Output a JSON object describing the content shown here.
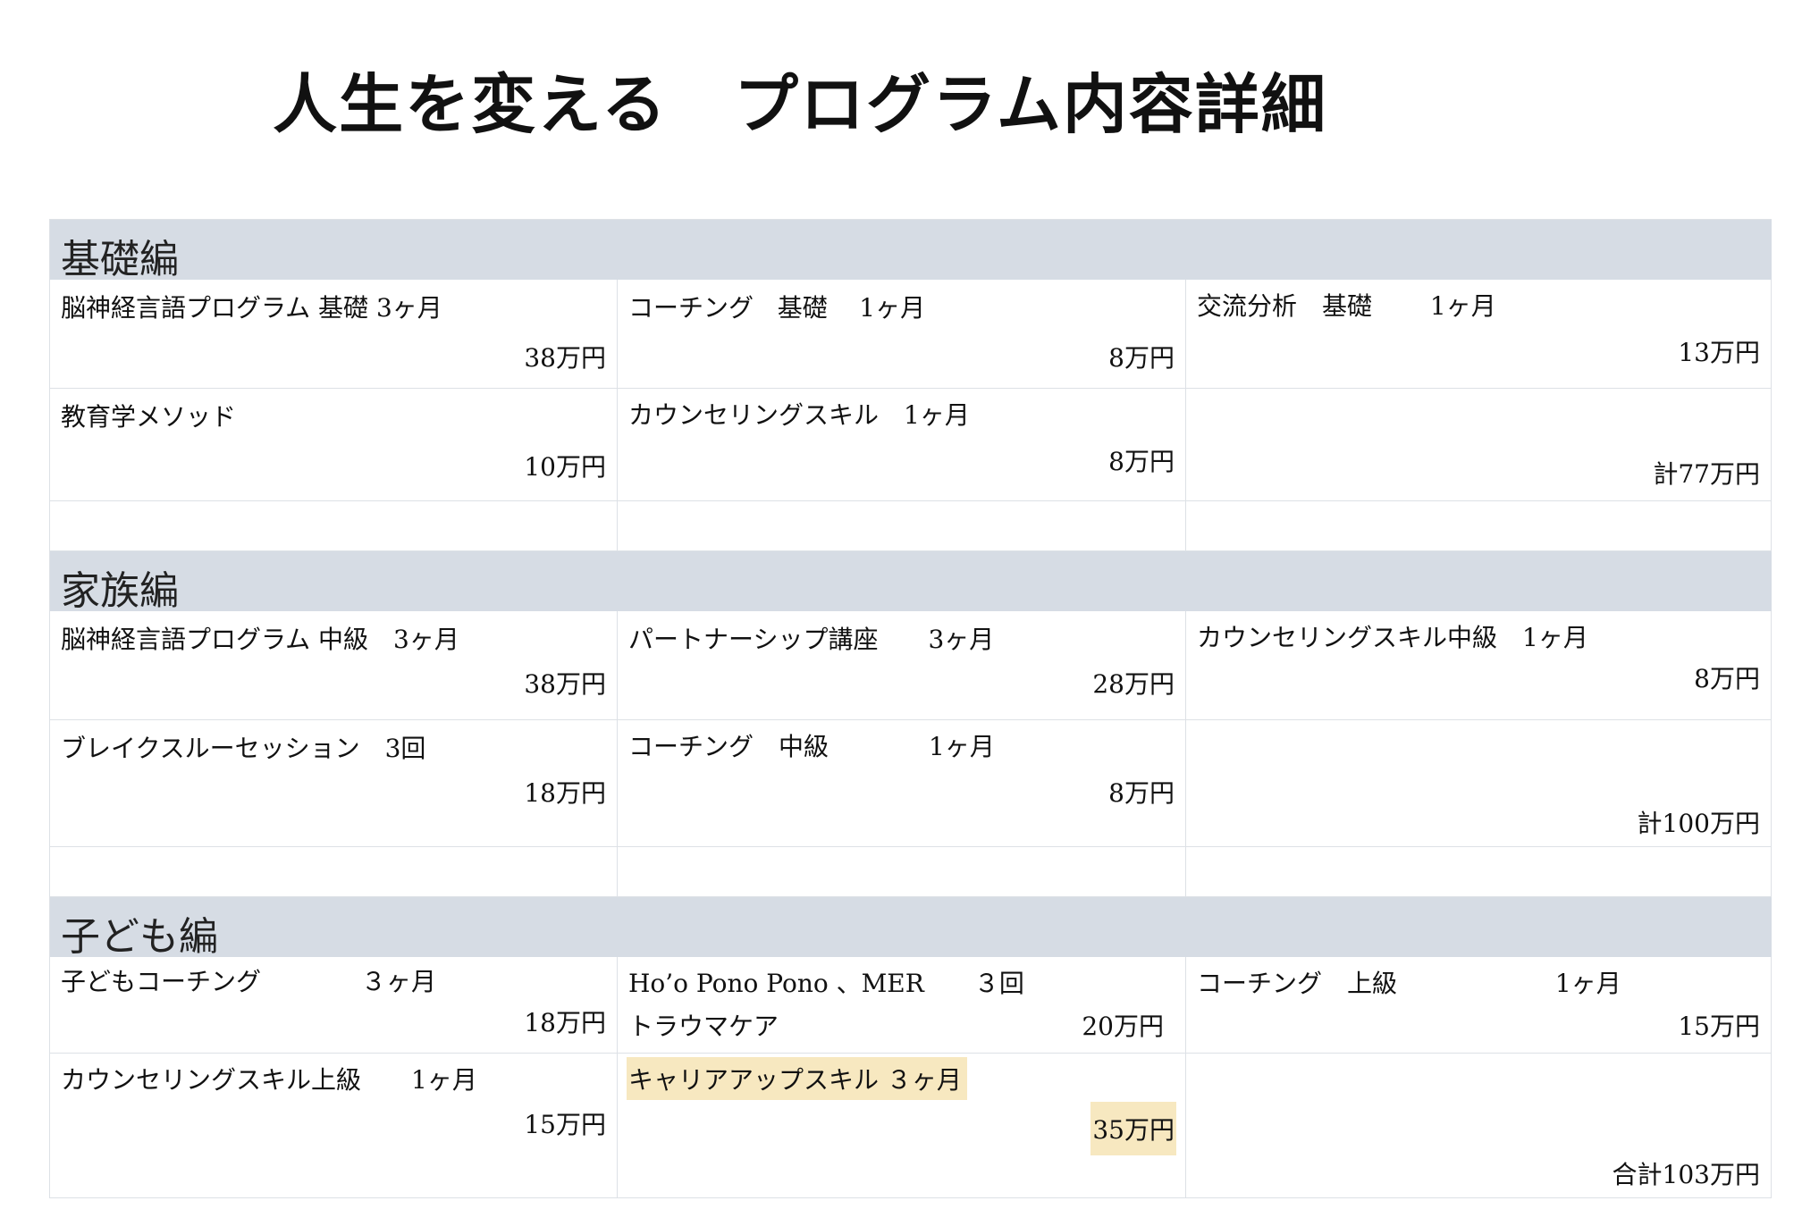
{
  "title": "人生を変える　プログラム内容詳細",
  "sections": [
    {
      "name": "基礎編",
      "rows": [
        [
          {
            "item": "脳神経言語プログラム 基礎 3ヶ月",
            "price": "38万円"
          },
          {
            "item": "コーチング   基礎    1ヶ月",
            "price": "8万円"
          },
          {
            "item": "交流分析　基礎　　 1ヶ月",
            "price": "13万円"
          }
        ],
        [
          {
            "item": "教育学メソッド",
            "price": "10万円"
          },
          {
            "item": "カウンセリングスキル　1ヶ月",
            "price": "8万円"
          },
          {
            "item": "",
            "price": "計77万円"
          }
        ]
      ]
    },
    {
      "name": "家族編",
      "rows": [
        [
          {
            "item": "脳神経言語プログラム 中級　3ヶ月",
            "price": "38万円"
          },
          {
            "item": "パートナーシップ講座　　3ヶ月",
            "price": "28万円"
          },
          {
            "item": "カウンセリングスキル中級　1ヶ月",
            "price": "8万円"
          }
        ],
        [
          {
            "item": "ブレイクスルーセッション　3回",
            "price": "18万円"
          },
          {
            "item": "コーチング　中級　　　　1ヶ月",
            "price": "8万円"
          },
          {
            "item": "",
            "price": "計100万円"
          }
        ]
      ]
    },
    {
      "name": "子ども編",
      "rows": [
        [
          {
            "item": "子どもコーチング　　　　３ヶ月",
            "price": "18万円"
          },
          {
            "item": "Ho’o Pono Pono 、MER　　３回",
            "item2": "トラウマケア",
            "price": "20万円"
          },
          {
            "item": "コーチング　上級　　　　　　 1ヶ月",
            "price": "15万円"
          }
        ],
        [
          {
            "item": "カウンセリングスキル上級　　1ヶ月",
            "price": "15万円"
          },
          {
            "item": "キャリアアップスキル ３ヶ月",
            "price": "35万円",
            "highlight_color": "#f7e8c0"
          },
          {
            "item": "",
            "price": "合計103万円"
          }
        ]
      ]
    }
  ]
}
